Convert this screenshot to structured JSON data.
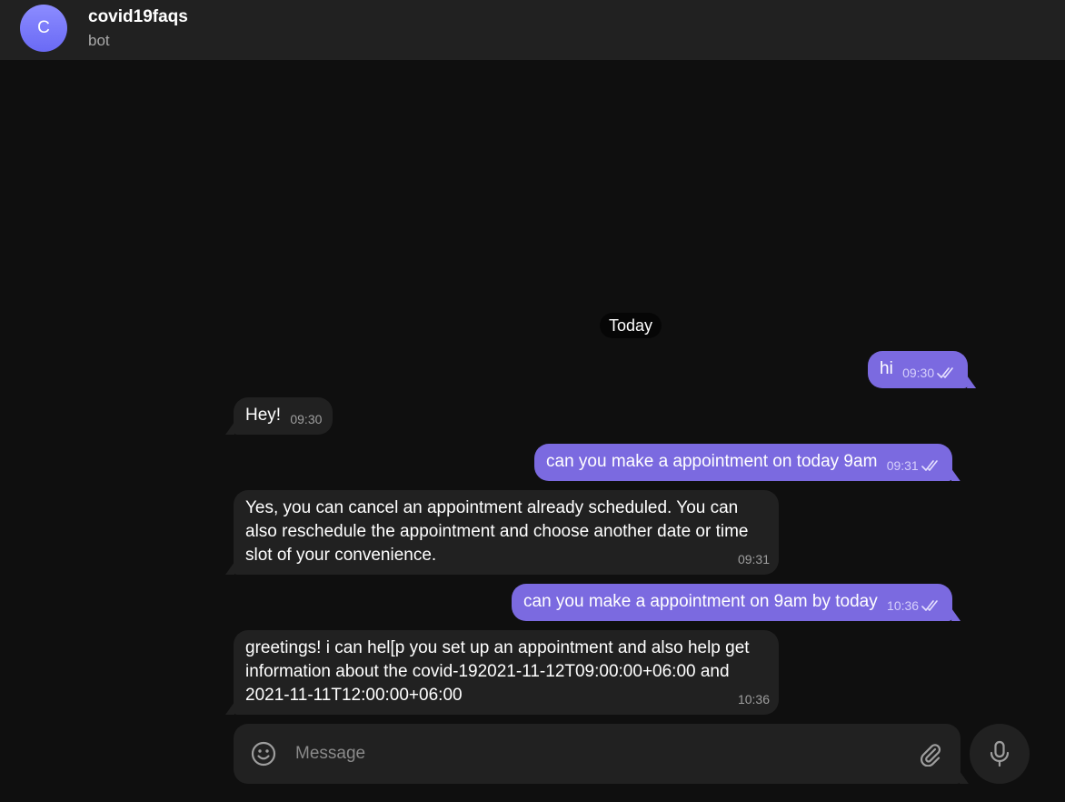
{
  "header": {
    "avatar_letter": "C",
    "title": "covid19faqs",
    "subtitle": "bot",
    "avatar_color": "#7a7af8"
  },
  "chat": {
    "date_label": "Today",
    "messages": [
      {
        "direction": "out",
        "text": "hi",
        "time": "09:30",
        "status": "read"
      },
      {
        "direction": "in",
        "text": "Hey!",
        "time": "09:30"
      },
      {
        "direction": "out",
        "text": "can you make a appointment on today 9am",
        "time": "09:31",
        "status": "read"
      },
      {
        "direction": "in",
        "text": "Yes, you can cancel an appointment already scheduled. You can also reschedule the appointment and choose another date or time slot of your convenience.",
        "time": "09:31"
      },
      {
        "direction": "out",
        "text": "can you make a appointment on 9am by today",
        "time": "10:36",
        "status": "read"
      },
      {
        "direction": "in",
        "text": "greetings! i can hel[p you set up an appointment and also help get information about the covid-192021-11-12T09:00:00+06:00 and 2021-11-11T12:00:00+06:00",
        "time": "10:36"
      }
    ]
  },
  "composer": {
    "placeholder": "Message",
    "value": "",
    "emoji_icon": "smile-icon",
    "attach_icon": "paperclip-icon",
    "mic_icon": "microphone-icon"
  },
  "colors": {
    "background": "#0f0f0f",
    "panel": "#212121",
    "outgoing_bubble": "#7b6ae0",
    "incoming_bubble": "#212121"
  }
}
